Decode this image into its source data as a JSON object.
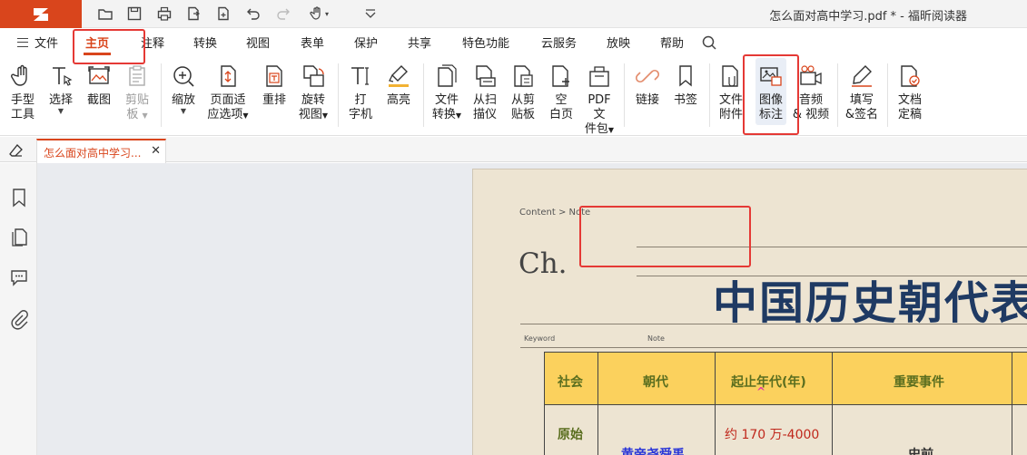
{
  "window": {
    "title": "怎么面对高中学习.pdf * - 福昕阅读器"
  },
  "quick_access": [
    "open-icon",
    "save-icon",
    "print-icon",
    "export-icon",
    "new-icon",
    "undo-icon",
    "redo-icon",
    "hand-icon",
    "customize-icon"
  ],
  "menu": {
    "file_label": "文件",
    "tabs": [
      "主页",
      "注释",
      "转换",
      "视图",
      "表单",
      "保护",
      "共享",
      "特色功能",
      "云服务",
      "放映",
      "帮助"
    ],
    "active_tab": "主页"
  },
  "ribbon": {
    "hand_tool": "手型工具",
    "hand_tool_l1": "手型",
    "hand_tool_l2": "工具",
    "select": "选择",
    "screenshot": "截图",
    "paste_l1": "剪贴",
    "paste_l2": "板",
    "zoom": "缩放",
    "page_fit_l1": "页面适",
    "page_fit_l2": "应选项",
    "reflow": "重排",
    "rotate_l1": "旋转",
    "rotate_l2": "视图",
    "typewriter_l1": "打",
    "typewriter_l2": "字机",
    "highlight": "高亮",
    "file_convert_l1": "文件",
    "file_convert_l2": "转换",
    "from_scanner_l1": "从扫",
    "from_scanner_l2": "描仪",
    "from_clipboard_l1": "从剪",
    "from_clipboard_l2": "贴板",
    "blank_l1": "空",
    "blank_l2": "白页",
    "pdf_package_l1": "PDF文",
    "pdf_package_l2": "件包",
    "link": "链接",
    "bookmark": "书签",
    "attachment_l1": "文件",
    "attachment_l2": "附件",
    "image_annot_l1": "图像",
    "image_annot_l2": "标注",
    "av_l1": "音频",
    "av_l2": "& 视频",
    "fill_sign_l1": "填写",
    "fill_sign_l2": "&签名",
    "finalize_l1": "文档",
    "finalize_l2": "定稿"
  },
  "doc_tab": {
    "label": "怎么面对高中学习..."
  },
  "document": {
    "breadcrumb": "Content > Note",
    "chapter": "Ch.",
    "title": "中国历史朝代表",
    "keyword_label": "Keyword",
    "note_label": "Note",
    "headers": [
      "社会",
      "朝代",
      "起止年代(年)",
      "重要事件"
    ],
    "row1": {
      "society": "原始",
      "dynasty": "黄帝尧舜禹",
      "period": "约 170 万-4000",
      "event": "史前"
    },
    "cursor_mark": "^"
  },
  "colors": {
    "accent": "#d9451c",
    "highlight_box": "#e53935",
    "table_header": "#fbd15d",
    "title_blue": "#1f3a63"
  }
}
